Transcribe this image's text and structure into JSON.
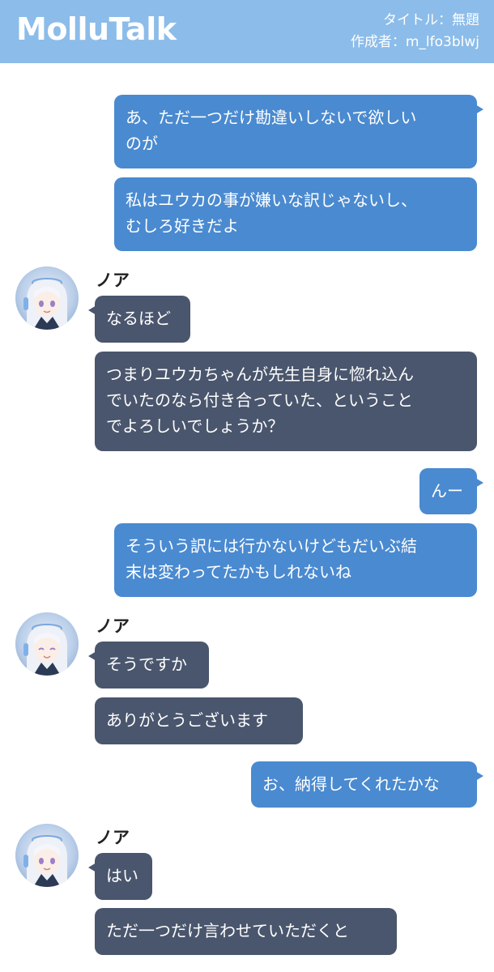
{
  "header": {
    "logo": "MolluTalk",
    "title_line": "タイトル：無題",
    "author_line": "作成者：m_lfo3blwj"
  },
  "messages": [
    {
      "sender": "me",
      "lines": [
        "あ、ただ一つだけ勘違いしないで欲しい",
        "のが"
      ]
    },
    {
      "sender": "me",
      "lines": [
        "私はユウカの事が嫌いな訳じゃないし、",
        "むしろ好きだよ"
      ]
    },
    {
      "sender": "them",
      "name": "ノア",
      "lines": [
        "なるほど"
      ]
    },
    {
      "sender": "them",
      "lines": [
        "つまりユウカちゃんが先生自身に惚れ込ん",
        "でいたのなら付き合っていた、ということ",
        "でよろしいでしょうか？"
      ]
    },
    {
      "sender": "me",
      "lines": [
        "んー"
      ]
    },
    {
      "sender": "me",
      "lines": [
        "そういう訳には行かないけどもだいぶ結",
        "末は変わってたかもしれないね"
      ]
    },
    {
      "sender": "them",
      "name": "ノア",
      "lines": [
        "そうですか"
      ]
    },
    {
      "sender": "them",
      "lines": [
        "ありがとうございます"
      ]
    },
    {
      "sender": "me",
      "lines": [
        "お、納得してくれたかな"
      ]
    },
    {
      "sender": "them",
      "name": "ノア",
      "lines": [
        "はい"
      ]
    },
    {
      "sender": "them",
      "lines": [
        "ただ一つだけ言わせていただくと"
      ]
    }
  ],
  "colors": {
    "header": "#8cbce9",
    "my_bubble": "#4a8ad0",
    "their_bubble": "#4a566d"
  },
  "icons": {
    "avatar": "character-avatar-noa"
  }
}
